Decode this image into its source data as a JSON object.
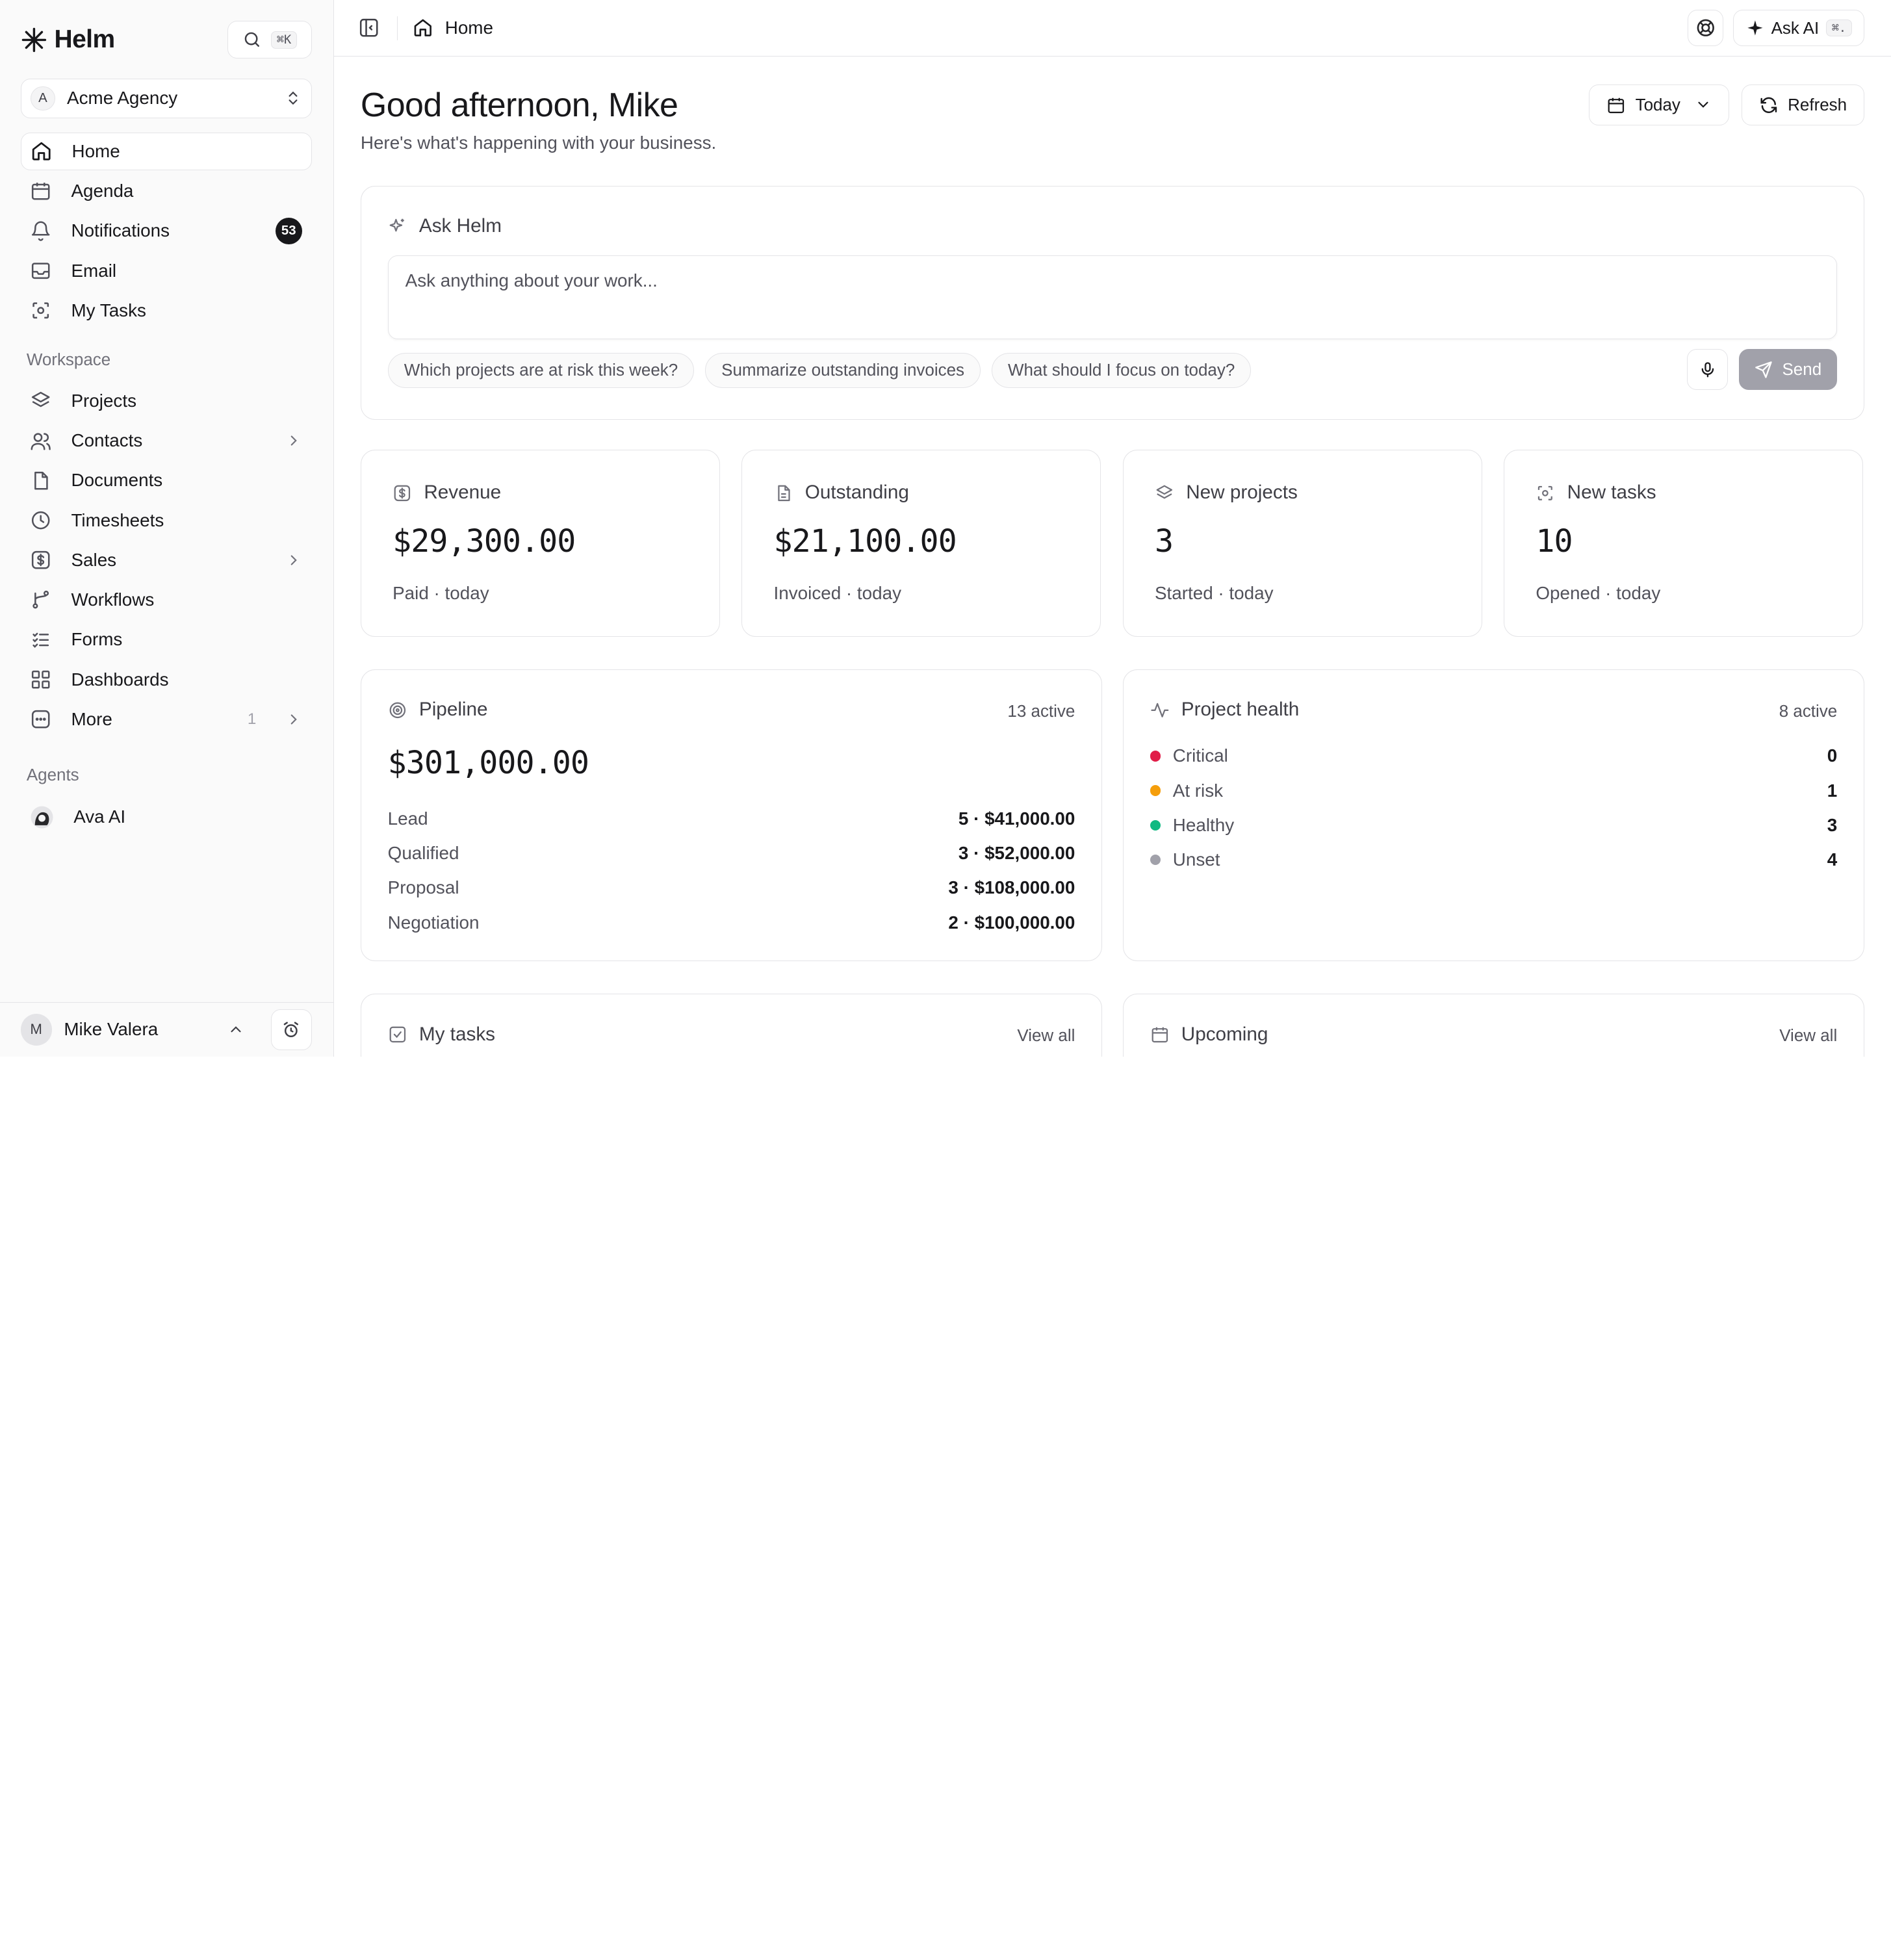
{
  "sidebar": {
    "brand": "Helm",
    "search_shortcut": "⌘K",
    "org": {
      "initial": "A",
      "name": "Acme Agency"
    },
    "primary": [
      {
        "label": "Home",
        "icon": "home-icon"
      },
      {
        "label": "Agenda",
        "icon": "calendar-icon"
      },
      {
        "label": "Notifications",
        "icon": "bell-icon",
        "badge": "53"
      },
      {
        "label": "Email",
        "icon": "inbox-icon"
      },
      {
        "label": "My Tasks",
        "icon": "task-icon"
      }
    ],
    "workspace_title": "Workspace",
    "workspace": [
      {
        "label": "Projects",
        "icon": "layers-icon"
      },
      {
        "label": "Contacts",
        "icon": "users-icon"
      },
      {
        "label": "Documents",
        "icon": "file-icon"
      },
      {
        "label": "Timesheets",
        "icon": "clock-icon"
      },
      {
        "label": "Sales",
        "icon": "dollar-icon"
      },
      {
        "label": "Workflows",
        "icon": "workflow-icon"
      },
      {
        "label": "Forms",
        "icon": "list-icon"
      },
      {
        "label": "Dashboards",
        "icon": "grid-icon"
      },
      {
        "label": "More",
        "icon": "more-icon",
        "count": "1"
      }
    ],
    "agents_title": "Agents",
    "agents": [
      {
        "label": "Ava AI"
      }
    ],
    "user": {
      "initial": "M",
      "name": "Mike Valera"
    }
  },
  "topbar": {
    "breadcrumb": "Home",
    "ask_ai_label": "Ask AI",
    "ask_ai_shortcut": "⌘."
  },
  "header": {
    "greeting": "Good afternoon, Mike",
    "subtitle": "Here's what's happening with your business.",
    "range_label": "Today",
    "refresh_label": "Refresh"
  },
  "ask": {
    "title": "Ask Helm",
    "placeholder": "Ask anything about your work...",
    "suggestions": [
      "Which projects are at risk this week?",
      "Summarize outstanding invoices",
      "What should I focus on today?"
    ],
    "send_label": "Send"
  },
  "stats": [
    {
      "title": "Revenue",
      "value": "$29,300.00",
      "foot": "Paid · today"
    },
    {
      "title": "Outstanding",
      "value": "$21,100.00",
      "foot": "Invoiced · today"
    },
    {
      "title": "New projects",
      "value": "3",
      "foot": "Started · today"
    },
    {
      "title": "New tasks",
      "value": "10",
      "foot": "Opened · today"
    }
  ],
  "pipeline": {
    "title": "Pipeline",
    "meta": "13 active",
    "total": "$301,000.00",
    "rows": [
      {
        "label": "Lead",
        "value": "5 · $41,000.00"
      },
      {
        "label": "Qualified",
        "value": "3 · $52,000.00"
      },
      {
        "label": "Proposal",
        "value": "3 · $108,000.00"
      },
      {
        "label": "Negotiation",
        "value": "2 · $100,000.00"
      }
    ]
  },
  "health": {
    "title": "Project health",
    "meta": "8 active",
    "rows": [
      {
        "label": "Critical",
        "value": "0",
        "color": "#e11d48"
      },
      {
        "label": "At risk",
        "value": "1",
        "color": "#f59e0b"
      },
      {
        "label": "Healthy",
        "value": "3",
        "color": "#10b981"
      },
      {
        "label": "Unset",
        "value": "4",
        "color": "#a1a1aa"
      }
    ]
  },
  "my_tasks": {
    "title": "My tasks",
    "view_all": "View all"
  },
  "upcoming": {
    "title": "Upcoming",
    "view_all": "View all"
  }
}
